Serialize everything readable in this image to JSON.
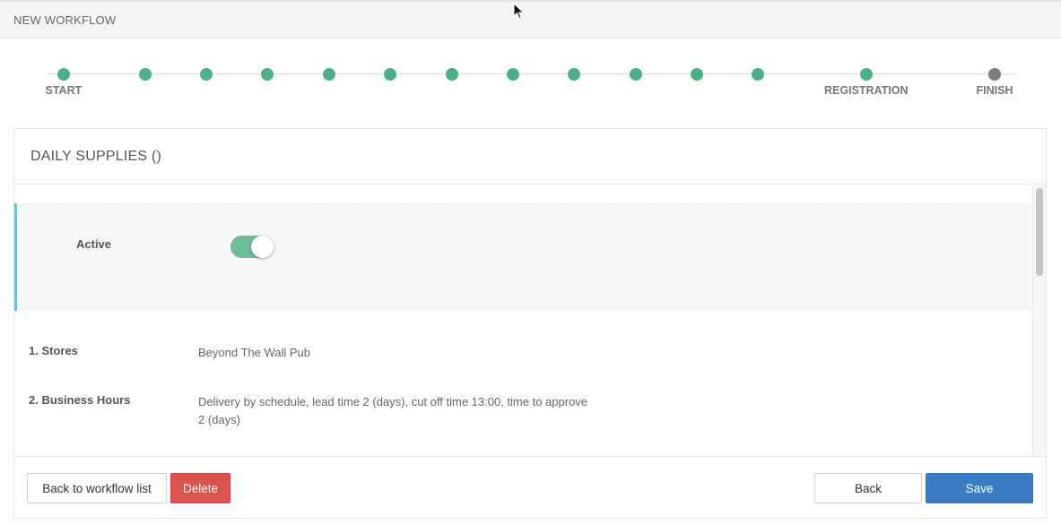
{
  "header": {
    "title": "NEW WORKFLOW"
  },
  "progress": {
    "steps": [
      {
        "label": "START",
        "status": "done"
      },
      {
        "label": "",
        "status": "done"
      },
      {
        "label": "",
        "status": "done"
      },
      {
        "label": "",
        "status": "done"
      },
      {
        "label": "",
        "status": "done"
      },
      {
        "label": "",
        "status": "done"
      },
      {
        "label": "",
        "status": "done"
      },
      {
        "label": "",
        "status": "done"
      },
      {
        "label": "",
        "status": "done"
      },
      {
        "label": "",
        "status": "done"
      },
      {
        "label": "",
        "status": "done"
      },
      {
        "label": "",
        "status": "done"
      },
      {
        "label": "REGISTRATION",
        "status": "done"
      },
      {
        "label": "FINISH",
        "status": "pending"
      }
    ],
    "colors": {
      "done": "#4caf87",
      "pending": "#7d7d7d"
    }
  },
  "panel": {
    "title": "DAILY SUPPLIES ()",
    "active": {
      "label": "Active",
      "on": true
    },
    "fields": [
      {
        "key": "1. Stores",
        "value": "Beyond The Wall Pub"
      },
      {
        "key": "2. Business Hours",
        "value": "Delivery by schedule, lead time 2 (days), cut off time 13:00, time to approve 2 (days)"
      }
    ]
  },
  "footer": {
    "back_to_list": "Back to workflow list",
    "delete": "Delete",
    "back": "Back",
    "save": "Save"
  },
  "colors": {
    "accent": "#3a7dc4",
    "danger": "#d9534f",
    "toggle_on": "#6dbd98",
    "active_border": "#6fc0d0"
  }
}
